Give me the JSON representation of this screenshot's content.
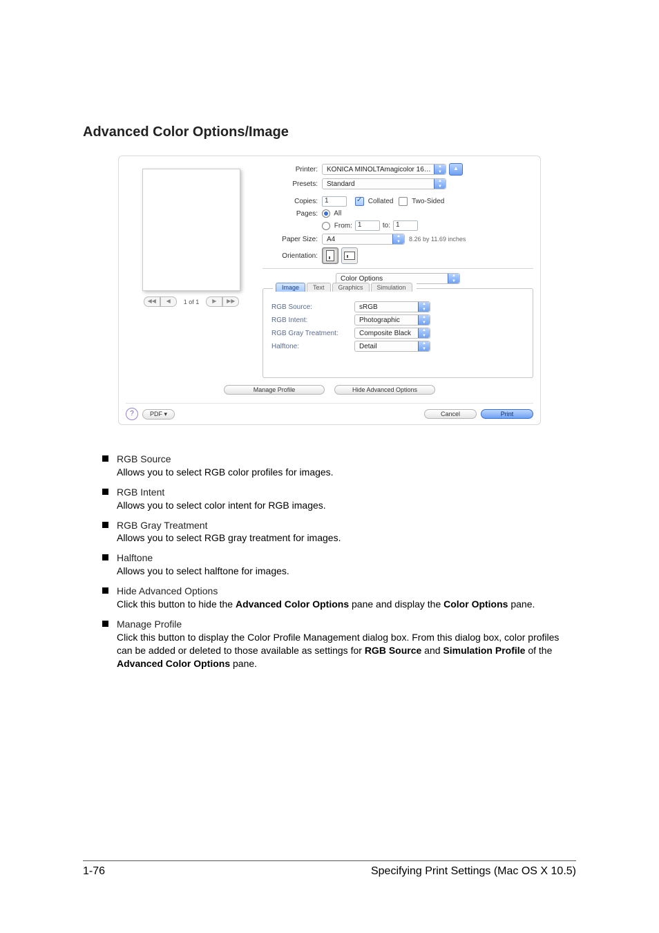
{
  "title": "Advanced Color Options/Image",
  "dialog": {
    "labels": {
      "printer": "Printer:",
      "presets": "Presets:",
      "copies": "Copies:",
      "pages": "Pages:",
      "paper_size": "Paper Size:",
      "orientation": "Orientation:"
    },
    "printer_value": "KONICA MINOLTAmagicolor 16…",
    "presets_value": "Standard",
    "copies_value": "1",
    "pages_all": "All",
    "pages_from_label": "From:",
    "pages_from": "1",
    "pages_to_label": "to:",
    "pages_to": "1",
    "collated_label": "Collated",
    "two_sided_label": "Two-Sided",
    "paper_size_value": "A4",
    "paper_size_info": "8.26 by 11.69 inches",
    "section_dropdown": "Color Options",
    "preview_page": "1 of 1",
    "nav": {
      "first": "◀◀",
      "prev": "◀",
      "next": "▶",
      "last": "▶▶"
    },
    "tabs": {
      "image": "Image",
      "text": "Text",
      "graphics": "Graphics",
      "simulation": "Simulation"
    },
    "color_fields": {
      "rgb_source": {
        "label": "RGB Source:",
        "value": "sRGB"
      },
      "rgb_intent": {
        "label": "RGB Intent:",
        "value": "Photographic"
      },
      "rgb_gray": {
        "label": "RGB Gray Treatment:",
        "value": "Composite Black"
      },
      "halftone": {
        "label": "Halftone:",
        "value": "Detail"
      }
    },
    "buttons": {
      "manage_profile": "Manage Profile",
      "hide_advanced": "Hide Advanced Options",
      "pdf": "PDF ▾",
      "cancel": "Cancel",
      "print": "Print",
      "help": "?"
    }
  },
  "list": {
    "rgb_source": {
      "h": "RGB Source",
      "p": "Allows you to select RGB color profiles for images."
    },
    "rgb_intent": {
      "h": "RGB Intent",
      "p": "Allows you to select color intent for RGB images."
    },
    "rgb_gray": {
      "h": "RGB Gray Treatment",
      "p": "Allows you to select RGB gray treatment for images."
    },
    "halftone": {
      "h": "Halftone",
      "p": "Allows you to select halftone for images."
    },
    "hide_adv": {
      "h": "Hide Advanced Options",
      "p1": "Click this button to hide the ",
      "b1": "Advanced Color Options",
      "p2": " pane and display the ",
      "b2": "Color Options",
      "p3": " pane."
    },
    "manage_profile": {
      "h": "Manage Profile",
      "p1": "Click this button to display the Color Profile Management dialog box. From this dialog box, color profiles can be added or deleted to those available as settings for ",
      "b1": "RGB Source",
      "p2": " and ",
      "b2": "Simulation Profile",
      "p3": " of the ",
      "b3": "Advanced Color Options",
      "p4": " pane."
    }
  },
  "footer": {
    "page_num": "1-76",
    "section": "Specifying Print Settings (Mac OS X 10.5)"
  }
}
